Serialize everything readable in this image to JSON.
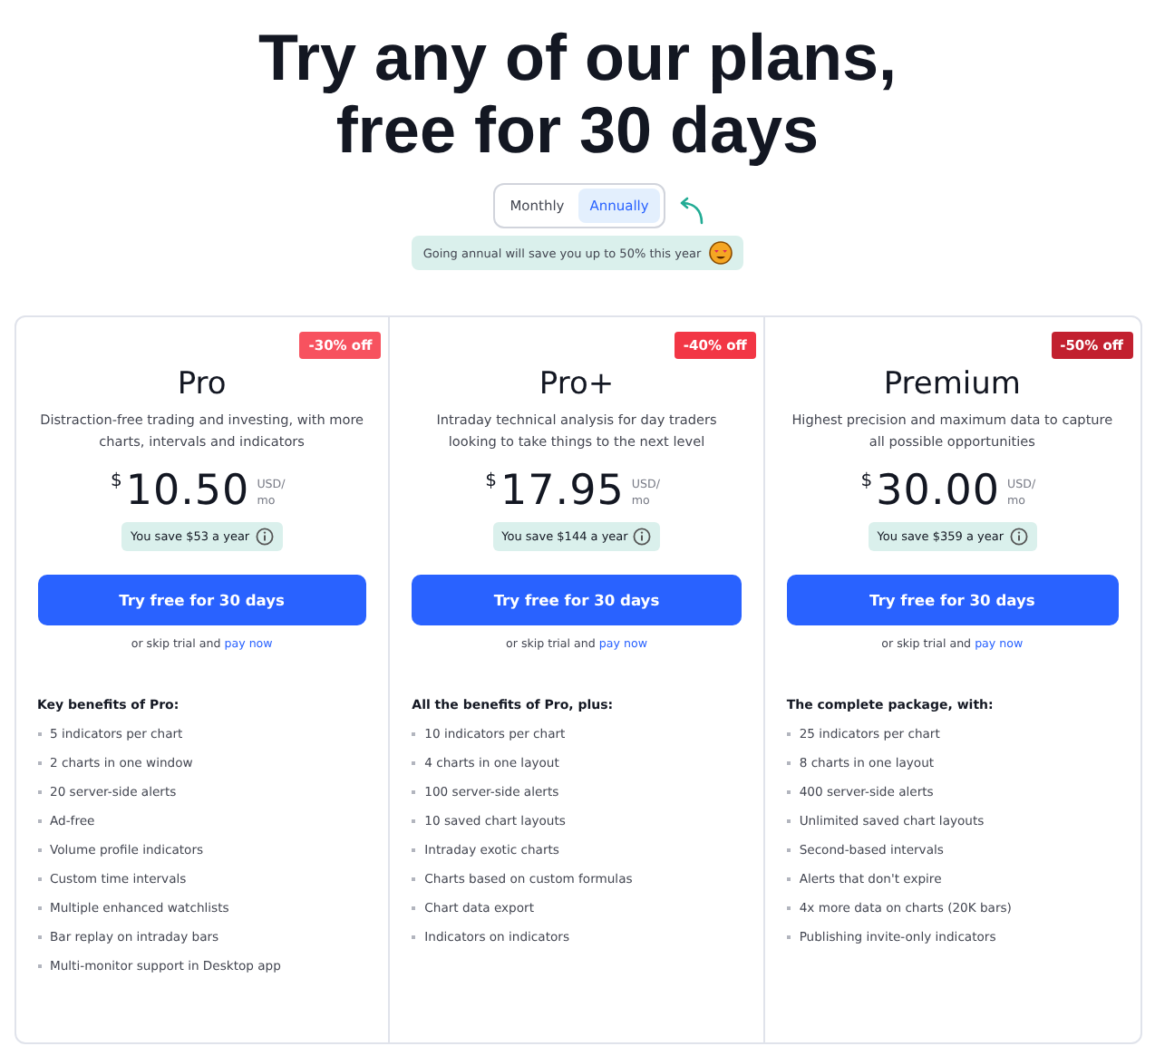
{
  "heading": "Try any of our plans, free for 30 days",
  "billing_toggle": [
    {
      "label": "Monthly",
      "selected": false
    },
    {
      "label": "Annually",
      "selected": true
    }
  ],
  "annual_note": "Going annual will save you up to 50% this year",
  "plans": [
    {
      "name": "Pro",
      "discount": "-30% off",
      "color": "#f7525f",
      "description": "Distraction-free trading and investing, with more charts, intervals and indicators",
      "currency": "$",
      "price": "10.50",
      "unit": "USD/ mo",
      "savings": "You save $53 a year",
      "cta": "Try free for 30 days",
      "skip_text": "or skip trial and",
      "skip_link": "pay now",
      "benefits_title": "Key benefits of Pro:",
      "benefits": [
        "5 indicators per chart",
        "2 charts in one window",
        "20 server-side alerts",
        "Ad-free",
        "Volume profile indicators",
        "Custom time intervals",
        "Multiple enhanced watchlists",
        "Bar replay on intraday bars",
        "Multi-monitor support in Desktop app"
      ]
    },
    {
      "name": "Pro+",
      "discount": "-40% off",
      "color": "#f23645",
      "description": "Intraday technical analysis for day traders looking to take things to the next level",
      "currency": "$",
      "price": "17.95",
      "unit": "USD/ mo",
      "savings": "You save $144 a year",
      "cta": "Try free for 30 days",
      "skip_text": "or skip trial and",
      "skip_link": "pay now",
      "benefits_title": "All the benefits of Pro, plus:",
      "benefits": [
        "10 indicators per chart",
        "4 charts in one layout",
        "100 server-side alerts",
        "10 saved chart layouts",
        "Intraday exotic charts",
        "Charts based on custom formulas",
        "Chart data export",
        "Indicators on indicators"
      ]
    },
    {
      "name": "Premium",
      "discount": "-50% off",
      "color": "#c2202f",
      "description": "Highest precision and maximum data to capture all possible opportunities",
      "currency": "$",
      "price": "30.00",
      "unit": "USD/ mo",
      "savings": "You save $359 a year",
      "cta": "Try free for 30 days",
      "skip_text": "or skip trial and",
      "skip_link": "pay now",
      "benefits_title": "The complete package, with:",
      "benefits": [
        "25 indicators per chart",
        "8 charts in one layout",
        "400 server-side alerts",
        "Unlimited saved chart layouts",
        "Second-based intervals",
        "Alerts that don't expire",
        "4x more data on charts (20K bars)",
        "Publishing invite-only indicators"
      ]
    }
  ]
}
